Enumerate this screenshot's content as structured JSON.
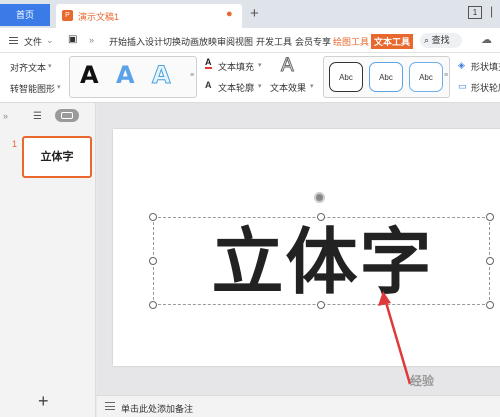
{
  "titlebar": {
    "home_tab": "首页",
    "doc_title": "演示文稿1",
    "window_badge": "1"
  },
  "menubar": {
    "file": "文件",
    "items": [
      "开始",
      "插入",
      "设计",
      "切换",
      "动画",
      "放映",
      "审阅",
      "视图",
      "开发工具",
      "会员专享"
    ],
    "draw_tool": "绘图工具",
    "text_tool": "文本工具",
    "search": "查找"
  },
  "ribbon": {
    "align_text": "对齐文本",
    "smart_shape": "转智能图形",
    "wordart": [
      "A",
      "A",
      "A"
    ],
    "text_fill": "文本填充",
    "text_outline": "文本轮廓",
    "text_effect": "文本效果",
    "shape_styles": [
      "Abc",
      "Abc",
      "Abc"
    ],
    "shape_fill": "形状填充",
    "shape_outline": "形状轮廓"
  },
  "slides_pane": {
    "slide_number": "1",
    "slide_title": "立体字",
    "add_slide": "+"
  },
  "slide": {
    "text": "立体字"
  },
  "notes": {
    "placeholder": "单击此处添加备注"
  },
  "watermark": "经验",
  "colors": {
    "accent": "#e8682e",
    "home_tab": "#3b7be7",
    "arrow": "#e0393b"
  }
}
